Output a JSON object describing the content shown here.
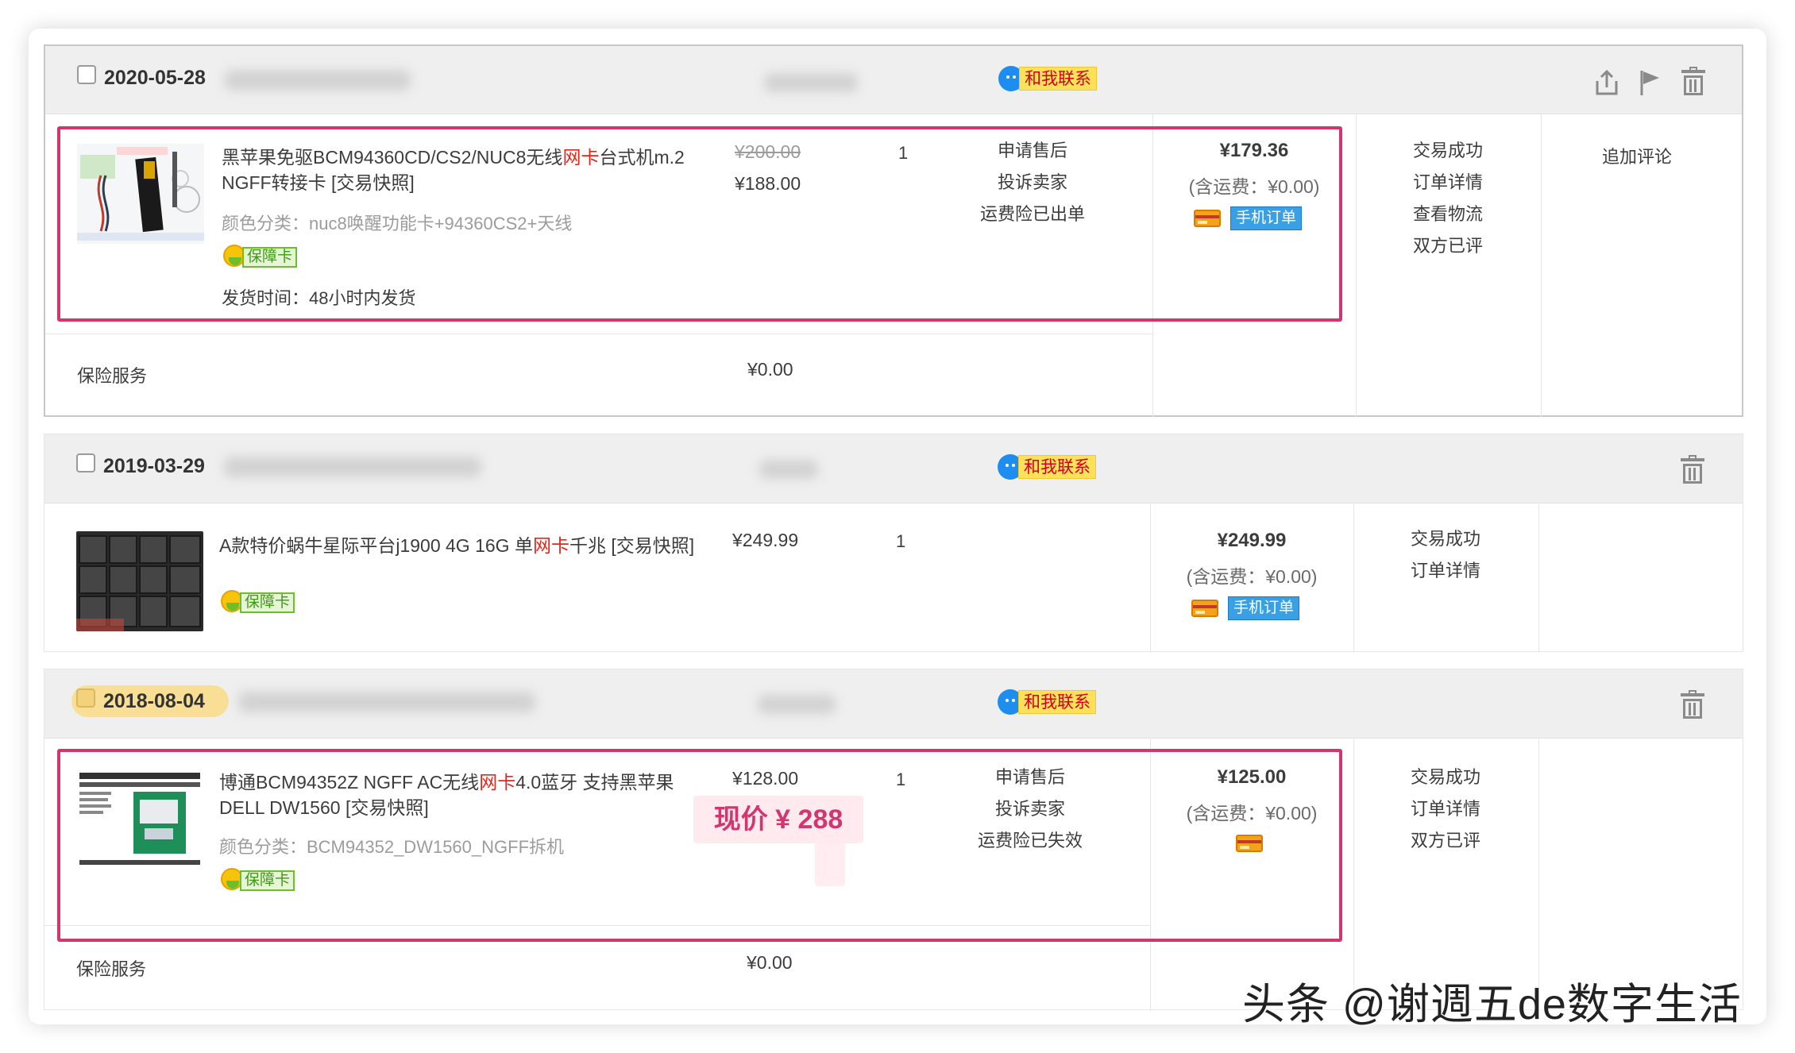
{
  "orders": [
    {
      "date": "2020-05-28",
      "contact_label": "和我联系",
      "item": {
        "title_pre": "黑苹果免驱BCM94360CD/CS2/NUC8无线",
        "title_kw": "网卡",
        "title_post": "台式机m.2 NGFF转接卡 [交易快照]",
        "spec": "颜色分类：nuc8唤醒功能卡+94360CS2+天线",
        "guarantee": "保障卡",
        "ship_time": "发货时间：48小时内发货",
        "original_price": "¥200.00",
        "price": "¥188.00",
        "qty": "1",
        "services": [
          "申请售后",
          "投诉卖家",
          "运费险已出单"
        ],
        "total": "¥179.36",
        "total_note": "(含运费：¥0.00)",
        "mobile_badge": "手机订单",
        "status": [
          "交易成功",
          "订单详情",
          "查看物流",
          "双方已评"
        ],
        "action": "追加评论"
      },
      "insurance": {
        "label": "保险服务",
        "price": "¥0.00"
      }
    },
    {
      "date": "2019-03-29",
      "contact_label": "和我联系",
      "item": {
        "title_pre": "A款特价蜗牛星际平台j1900 4G 16G 单",
        "title_kw": "网卡",
        "title_post": "千兆 [交易快照]",
        "guarantee": "保障卡",
        "price": "¥249.99",
        "qty": "1",
        "total": "¥249.99",
        "total_note": "(含运费：¥0.00)",
        "mobile_badge": "手机订单",
        "status": [
          "交易成功",
          "订单详情"
        ]
      }
    },
    {
      "date": "2018-08-04",
      "contact_label": "和我联系",
      "item": {
        "title_pre": "博通BCM94352Z NGFF AC无线",
        "title_kw": "网卡",
        "title_post": "4.0蓝牙 支持黑苹果DELL DW1560 [交易快照]",
        "spec": "颜色分类：BCM94352_DW1560_NGFF拆机",
        "guarantee": "保障卡",
        "price": "¥128.00",
        "qty": "1",
        "services": [
          "申请售后",
          "投诉卖家",
          "运费险已失效"
        ],
        "total": "¥125.00",
        "total_note": "(含运费：¥0.00)",
        "status": [
          "交易成功",
          "订单详情",
          "双方已评"
        ]
      },
      "insurance": {
        "label": "保险服务",
        "price": "¥0.00"
      }
    }
  ],
  "annotation": {
    "current_price": "现价 ¥ 288"
  },
  "watermark": "头条 @谢週五de数字生活",
  "colors": {
    "highlight": "#d3366f",
    "keyword": "#e4251b",
    "header_bg": "#efefef"
  }
}
